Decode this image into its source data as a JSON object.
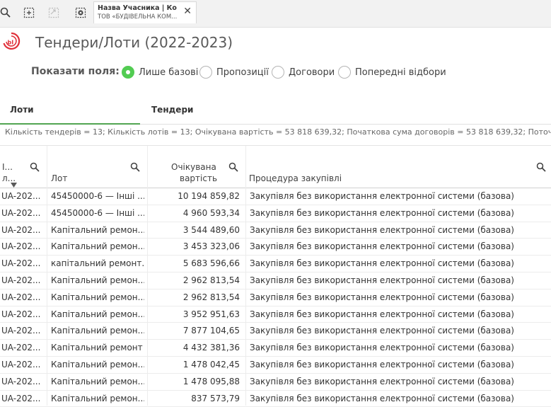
{
  "toolbar": {
    "selection": {
      "title": "Назва Учасника | Ко...",
      "value": "ТОВ «БУДІВЕЛЬНА КОМ..."
    }
  },
  "header": {
    "title": "Тендери/Лоти (2022-2023)"
  },
  "fields": {
    "label": "Показати поля:",
    "options": [
      "Лише базові",
      "Пропозиції",
      "Договори",
      "Попередні відбори"
    ],
    "selected": "Лише базові"
  },
  "tabs": [
    "Лоти",
    "Тендери"
  ],
  "summary": "Кількість тендерів = 13; Кількість лотів = 13; Очікувана вартість = 53 818 639,32; Початкова сума договорів = 53 818 639,32; Поточ",
  "table": {
    "headers": {
      "id_line1": "І...",
      "id_line2": "л...",
      "lot": "Лот",
      "value_line1": "Очікувана",
      "value_line2": "вартість",
      "procedure": "Процедура закупівлі"
    },
    "rows": [
      {
        "id": "UA-202...",
        "lot": "45450000-6 — Інші ...",
        "value": "10 194 859,82",
        "procedure": "Закупівля без використання електронної системи (базова)"
      },
      {
        "id": "UA-202...",
        "lot": "45450000-6 — Інші ...",
        "value": "4 960 593,34",
        "procedure": "Закупівля без використання електронної системи (базова)"
      },
      {
        "id": "UA-202...",
        "lot": "Капітальний ремон...",
        "value": "3 544 489,60",
        "procedure": "Закупівля без використання електронної системи (базова)"
      },
      {
        "id": "UA-202...",
        "lot": "Капітальний ремон...",
        "value": "3 453 323,06",
        "procedure": "Закупівля без використання електронної системи (базова)"
      },
      {
        "id": "UA-202...",
        "lot": "капітальний ремонт...",
        "value": "5 683 596,66",
        "procedure": "Закупівля без використання електронної системи (базова)"
      },
      {
        "id": "UA-202...",
        "lot": "Капітальний ремон...",
        "value": "2 962 813,54",
        "procedure": "Закупівля без використання електронної системи (базова)"
      },
      {
        "id": "UA-202...",
        "lot": "Капітальний ремон...",
        "value": "2 962 813,54",
        "procedure": "Закупівля без використання електронної системи (базова)"
      },
      {
        "id": "UA-202...",
        "lot": "Капітальний ремон...",
        "value": "3 952 951,63",
        "procedure": "Закупівля без використання електронної системи (базова)"
      },
      {
        "id": "UA-202...",
        "lot": "Капітальний ремон...",
        "value": "7 877 104,65",
        "procedure": "Закупівля без використання електронної системи (базова)"
      },
      {
        "id": "UA-202...",
        "lot": "Капітальний ремонт",
        "value": "4 432 381,36",
        "procedure": "Закупівля без використання електронної системи (базова)"
      },
      {
        "id": "UA-202...",
        "lot": "Капітальний ремон...",
        "value": "1 478 042,45",
        "procedure": "Закупівля без використання електронної системи (базова)"
      },
      {
        "id": "UA-202...",
        "lot": "Капітальний ремон...",
        "value": "1 478 095,88",
        "procedure": "Закупівля без використання електронної системи (базова)"
      },
      {
        "id": "UA-202...",
        "lot": "Капітальний ремон...",
        "value": "837 573,79",
        "procedure": "Закупівля без використання електронної системи (базова)"
      }
    ]
  },
  "colors": {
    "accent": "#52cc52",
    "logo": "#e0303a"
  }
}
